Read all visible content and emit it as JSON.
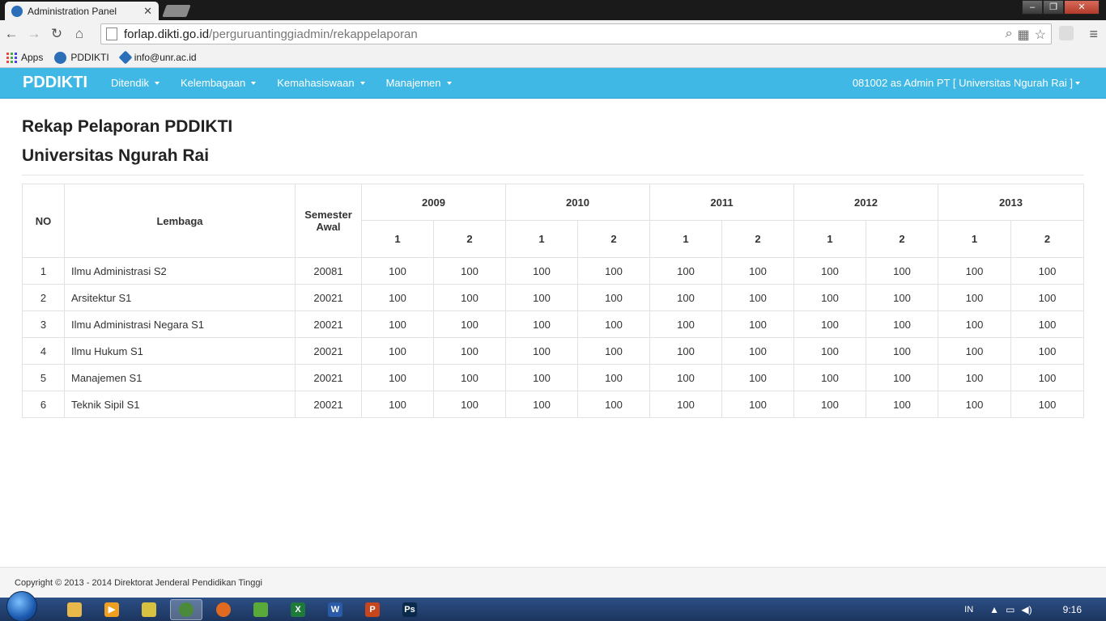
{
  "browser": {
    "tab_title": "Administration Panel",
    "tab_close": "✕",
    "url_host": "forlap.dikti.go.id",
    "url_path": "/perguruantinggiadmin/rekappelaporan",
    "bookmarks": [
      "Apps",
      "PDDIKTI",
      "info@unr.ac.id"
    ]
  },
  "navbar": {
    "brand": "PDDIKTI",
    "items": [
      "Ditendik",
      "Kelembagaan",
      "Kemahasiswaan",
      "Manajemen"
    ],
    "user": "081002 as Admin PT [ Universitas Ngurah Rai ]"
  },
  "page": {
    "title": "Rekap Pelaporan PDDIKTI",
    "subtitle": "Universitas Ngurah Rai"
  },
  "table": {
    "headers": {
      "no": "NO",
      "lembaga": "Lembaga",
      "semester_awal": "Semester Awal",
      "years": [
        "2009",
        "2010",
        "2011",
        "2012",
        "2013"
      ],
      "sub": [
        "1",
        "2"
      ]
    },
    "rows": [
      {
        "no": "1",
        "lembaga": "Ilmu Administrasi S2",
        "semester": "20081",
        "vals": [
          "100",
          "100",
          "100",
          "100",
          "100",
          "100",
          "100",
          "100",
          "100",
          "100"
        ]
      },
      {
        "no": "2",
        "lembaga": "Arsitektur S1",
        "semester": "20021",
        "vals": [
          "100",
          "100",
          "100",
          "100",
          "100",
          "100",
          "100",
          "100",
          "100",
          "100"
        ]
      },
      {
        "no": "3",
        "lembaga": "Ilmu Administrasi Negara S1",
        "semester": "20021",
        "vals": [
          "100",
          "100",
          "100",
          "100",
          "100",
          "100",
          "100",
          "100",
          "100",
          "100"
        ]
      },
      {
        "no": "4",
        "lembaga": "Ilmu Hukum S1",
        "semester": "20021",
        "vals": [
          "100",
          "100",
          "100",
          "100",
          "100",
          "100",
          "100",
          "100",
          "100",
          "100"
        ]
      },
      {
        "no": "5",
        "lembaga": "Manajemen S1",
        "semester": "20021",
        "vals": [
          "100",
          "100",
          "100",
          "100",
          "100",
          "100",
          "100",
          "100",
          "100",
          "100"
        ]
      },
      {
        "no": "6",
        "lembaga": "Teknik Sipil S1",
        "semester": "20021",
        "vals": [
          "100",
          "100",
          "100",
          "100",
          "100",
          "100",
          "100",
          "100",
          "100",
          "100"
        ]
      }
    ]
  },
  "footer": {
    "text": "Copyright © 2013 - 2014 Direktorat Jenderal Pendidikan Tinggi"
  },
  "taskbar": {
    "lang": "IN",
    "clock": "9:16",
    "apps": [
      {
        "name": "explorer",
        "label": "",
        "color": "#e8b84a"
      },
      {
        "name": "media-player",
        "label": "▶",
        "color": "#f0a020"
      },
      {
        "name": "app-3",
        "label": "",
        "color": "#d8c040"
      },
      {
        "name": "chrome",
        "label": "",
        "color": "#4a8a3a"
      },
      {
        "name": "firefox",
        "label": "",
        "color": "#e06a20"
      },
      {
        "name": "app-6",
        "label": "",
        "color": "#5aaa3a"
      },
      {
        "name": "excel",
        "label": "X",
        "color": "#1e7a3a"
      },
      {
        "name": "word",
        "label": "W",
        "color": "#2a5aa8"
      },
      {
        "name": "powerpoint",
        "label": "P",
        "color": "#c8461e"
      },
      {
        "name": "photoshop",
        "label": "Ps",
        "color": "#0a2a4a"
      }
    ]
  }
}
